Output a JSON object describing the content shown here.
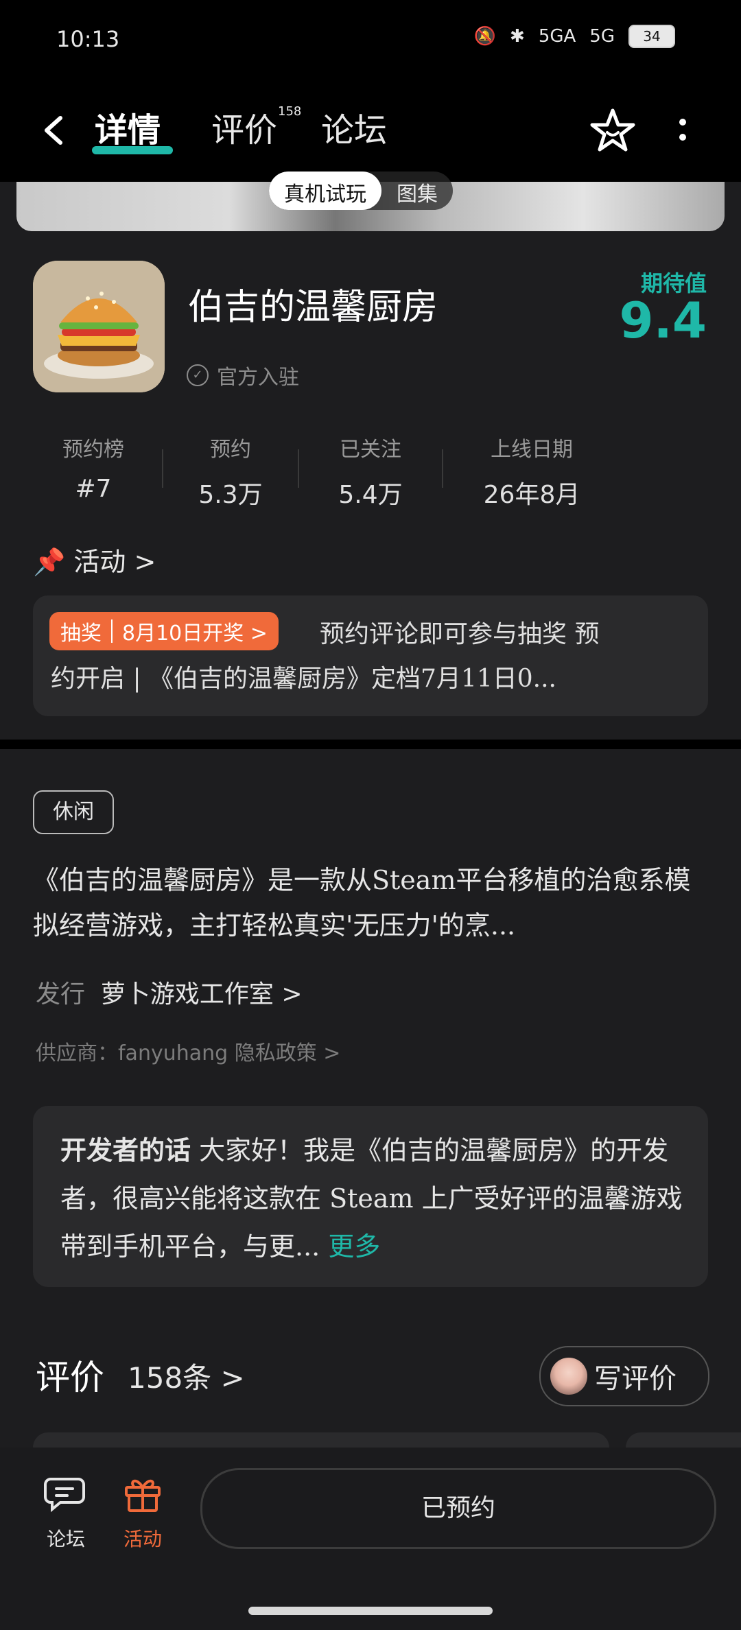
{
  "status_bar": {
    "time": "10:13",
    "signal1": "5GA",
    "signal2": "5G",
    "battery": "34"
  },
  "header": {
    "tabs": [
      {
        "label": "详情"
      },
      {
        "label": "评价",
        "count": "158"
      },
      {
        "label": "论坛"
      }
    ]
  },
  "banner": {
    "pill_trial": "真机试玩",
    "pill_gallery": "图集"
  },
  "game": {
    "title": "伯吉的温馨厨房",
    "official": "官方入驻",
    "expectation_label": "期待值",
    "expectation_value": "9.4"
  },
  "stats": [
    {
      "label": "预约榜",
      "value": "#7"
    },
    {
      "label": "预约",
      "value": "5.3万"
    },
    {
      "label": "已关注",
      "value": "5.4万"
    },
    {
      "label": "上线日期",
      "value": "26年8月"
    }
  ],
  "activity": {
    "heading": "活动 >",
    "badge_type": "抽奖",
    "badge_date": "8月10日开奖 >",
    "line1": "预约评论即可参与抽奖 预",
    "line2": "约开启 | 《伯吉的温馨厨房》定档7月11日0..."
  },
  "details": {
    "tag": "休闲",
    "description": "《伯吉的温馨厨房》是一款从Steam平台移植的治愈系模拟经营游戏，主打轻松真实'无压力'的烹...",
    "publisher_label": "发行",
    "publisher_value": "萝卜游戏工作室 >",
    "supplier": "供应商：fanyuhang    隐私政策 >"
  },
  "developer": {
    "label": "开发者的话",
    "text": "大家好！我是《伯吉的温馨厨房》的开发者，很高兴能将这款在 Steam 上广受好评的温馨游戏带到手机平台，与更...",
    "more": "更多"
  },
  "reviews": {
    "title": "评价",
    "count": "158条  >",
    "write_label": "写评价"
  },
  "bottom_nav": {
    "forum": "论坛",
    "activity": "活动",
    "reserve": "已预约"
  },
  "colors": {
    "accent": "#1fb8a8",
    "badge": "#f06a3a",
    "activity_nav": "#f06a3a"
  }
}
